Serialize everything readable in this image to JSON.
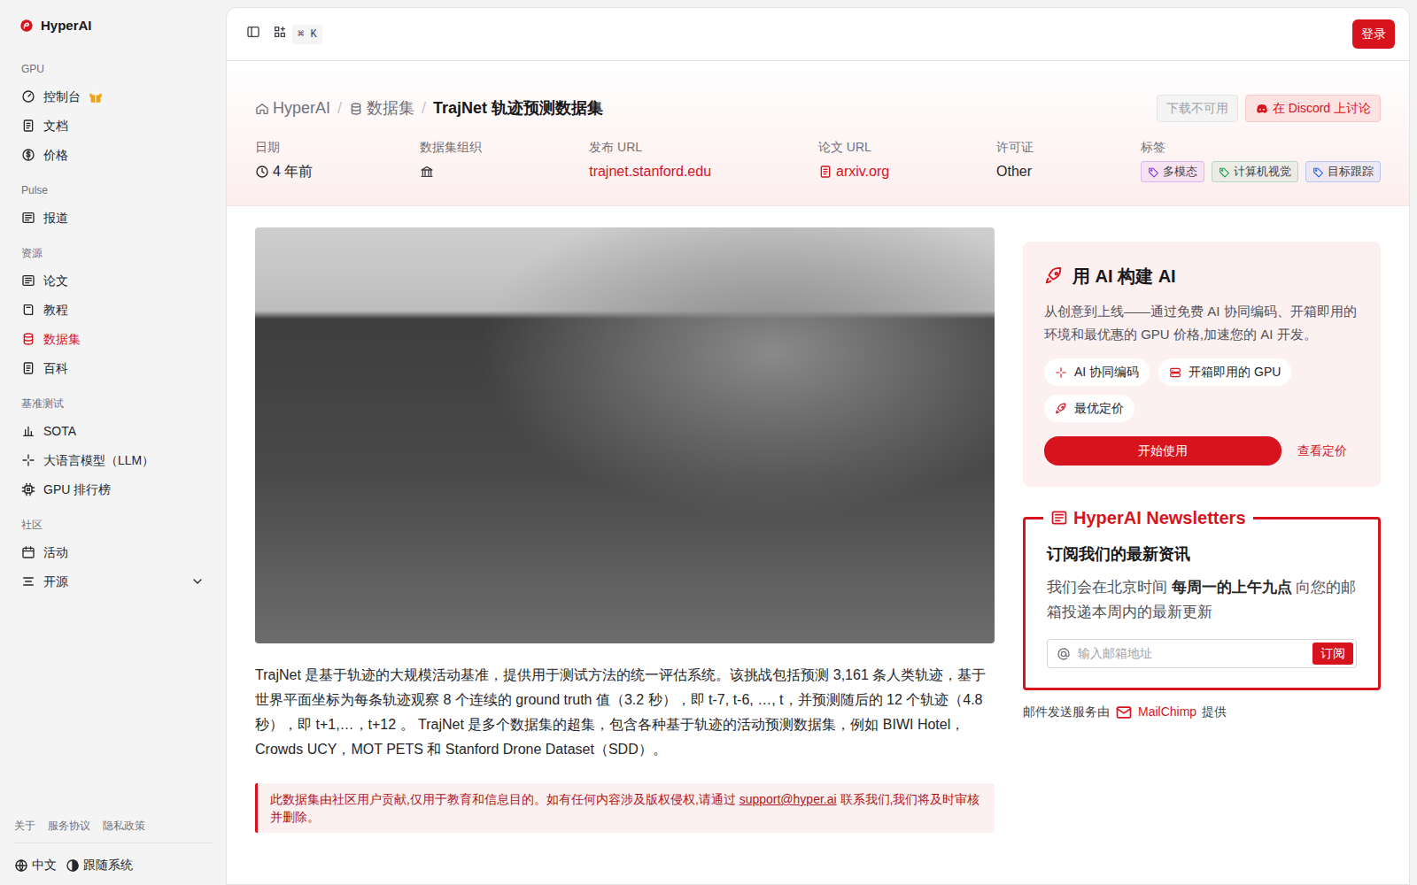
{
  "logo": {
    "text": "HyperAI"
  },
  "sidebar": {
    "sections": [
      {
        "title": "GPU",
        "items": [
          {
            "label": "控制台",
            "selected": false,
            "kind": "gift"
          },
          {
            "label": "文档",
            "selected": false,
            "kind": "link"
          },
          {
            "label": "价格",
            "selected": false,
            "kind": "link"
          }
        ]
      },
      {
        "title": "Pulse",
        "items": [
          {
            "label": "报道",
            "selected": false,
            "kind": "link"
          }
        ]
      },
      {
        "title": "资源",
        "items": [
          {
            "label": "论文",
            "selected": false,
            "kind": "link"
          },
          {
            "label": "教程",
            "selected": false,
            "kind": "link"
          },
          {
            "label": "数据集",
            "selected": true,
            "kind": "link"
          },
          {
            "label": "百科",
            "selected": false,
            "kind": "link"
          }
        ]
      },
      {
        "title": "基准测试",
        "items": [
          {
            "label": "SOTA",
            "selected": false,
            "kind": "link"
          },
          {
            "label": "大语言模型（LLM）",
            "selected": false,
            "kind": "link"
          },
          {
            "label": "GPU 排行榜",
            "selected": false,
            "kind": "link"
          }
        ]
      },
      {
        "title": "社区",
        "items": [
          {
            "label": "活动",
            "selected": false,
            "kind": "link"
          },
          {
            "label": "开源",
            "selected": false,
            "kind": "group",
            "expanded": false
          }
        ]
      }
    ],
    "footer": {
      "links": [
        "关于",
        "服务协议",
        "隐私政策"
      ],
      "language": "中文",
      "theme": "跟随系统"
    }
  },
  "topbar": {
    "shortcut": "⌘ K",
    "login": "登录"
  },
  "breadcrumb": {
    "separator": "/",
    "items": [
      "HyperAI",
      "数据集",
      "TrajNet 轨迹预测数据集"
    ]
  },
  "actions": {
    "download": {
      "label": "下载不可用",
      "disabled": true
    },
    "discord": {
      "label": "在 Discord 上讨论"
    }
  },
  "meta": [
    {
      "label": "日期",
      "value": "4 年前",
      "kind": "date"
    },
    {
      "label": "数据集组织",
      "value": "",
      "kind": "org"
    },
    {
      "label": "发布 URL",
      "value": "trajnet.stanford.edu",
      "kind": "link"
    },
    {
      "label": "论文 URL",
      "value": "arxiv.org",
      "kind": "paper"
    },
    {
      "label": "许可证",
      "value": "Other",
      "kind": "text"
    },
    {
      "label": "标签",
      "value": "",
      "kind": "tags",
      "tags": [
        {
          "label": "多模态",
          "color": "#9333ea"
        },
        {
          "label": "计算机视觉",
          "color": "#16a34a"
        },
        {
          "label": "目标跟踪",
          "color": "#2563eb"
        }
      ]
    }
  ],
  "description": "TrajNet 是基于轨迹的大规模活动基准，提供用于测试方法的统一评估系统。该挑战包括预测 3,161 条人类轨迹，基于世界平面坐标为每条轨迹观察 8 个连续的 ground truth 值（3.2 秒），即 t-7, t-6, …, t，并预测随后的 12 个轨迹（4.8 秒），即 t+1,…，t+12 。 TrajNet 是多个数据集的超集，包含各种基于轨迹的活动预测数据集，例如 BIWI Hotel，Crowds UCY，MOT PETS 和 Stanford Drone Dataset（SDD）。",
  "notice": {
    "before": "此数据集由社区用户贡献,仅用于教育和信息目的。如有任何内容涉及版权侵权,请通过 ",
    "email": "support@hyper.ai",
    "after": " 联系我们,我们将及时审核并删除。"
  },
  "promo": {
    "title": "用 AI 构建 AI",
    "text": "从创意到上线——通过免费 AI 协同编码、开箱即用的环境和最优惠的 GPU 价格,加速您的 AI 开发。",
    "features": [
      "AI 协同编码",
      "开箱即用的 GPU",
      "最优定价"
    ],
    "primary": "开始使用",
    "secondary": "查看定价"
  },
  "newsletter": {
    "title": "HyperAI Newsletters",
    "heading": "订阅我们的最新资讯",
    "text_before": "我们会在北京时间 ",
    "text_bold": "每周一的上午九点",
    "text_after": " 向您的邮箱投递本周内的最新更新",
    "placeholder": "输入邮箱地址",
    "button": "订阅"
  },
  "mail": {
    "before": "邮件发送服务由 ",
    "provider": "MailChimp",
    "after": " 提供"
  }
}
